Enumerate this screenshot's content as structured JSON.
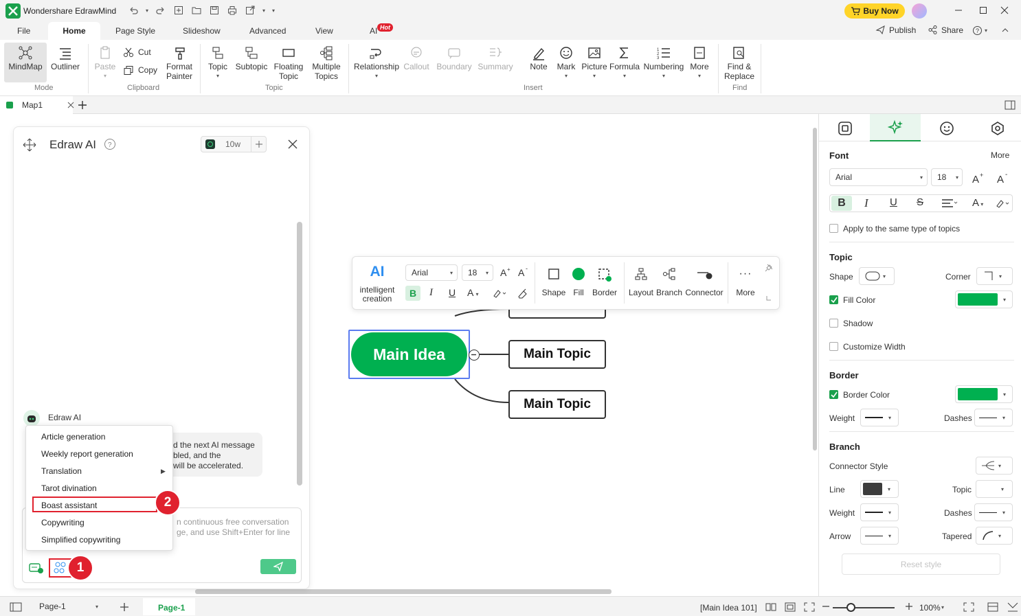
{
  "app": {
    "title": "Wondershare EdrawMind",
    "buy_now": "Buy Now",
    "publish": "Publish",
    "share": "Share"
  },
  "menu": {
    "file": "File",
    "home": "Home",
    "page_style": "Page Style",
    "slideshow": "Slideshow",
    "advanced": "Advanced",
    "view": "View",
    "ai": "AI",
    "hot": "Hot"
  },
  "ribbon": {
    "mindmap": "MindMap",
    "outliner": "Outliner",
    "mode": "Mode",
    "paste": "Paste",
    "cut": "Cut",
    "copy": "Copy",
    "format_painter_1": "Format",
    "format_painter_2": "Painter",
    "clipboard": "Clipboard",
    "topic": "Topic",
    "subtopic": "Subtopic",
    "floating_1": "Floating",
    "floating_2": "Topic",
    "multiple_1": "Multiple",
    "multiple_2": "Topics",
    "topic_group": "Topic",
    "relationship": "Relationship",
    "callout": "Callout",
    "boundary": "Boundary",
    "summary": "Summary",
    "note": "Note",
    "mark": "Mark",
    "picture": "Picture",
    "formula": "Formula",
    "numbering": "Numbering",
    "more": "More",
    "insert": "Insert",
    "find_1": "Find &",
    "find_2": "Replace",
    "find": "Find"
  },
  "tabs": {
    "doc": "Map1"
  },
  "ai_panel": {
    "title": "Edraw AI",
    "credits": "10w",
    "sender": "Edraw AI",
    "msg_line1": "d the next AI message",
    "msg_line2": "bled, and the",
    "msg_line3": "will be accelerated.",
    "input_line1": "n continuous free conversation",
    "input_line2": "ge, and use Shift+Enter for line",
    "menu": [
      "Article generation",
      "Weekly report generation",
      "Translation",
      "Tarot divination",
      "Boast assistant",
      "Copywriting",
      "Simplified copywriting"
    ],
    "badge1": "1",
    "badge2": "2"
  },
  "floatbar": {
    "ai": "AI",
    "intelligent": "intelligent",
    "creation": "creation",
    "font": "Arial",
    "size": "18",
    "shape": "Shape",
    "fill": "Fill",
    "border": "Border",
    "layout": "Layout",
    "branch": "Branch",
    "connector": "Connector",
    "more": "More"
  },
  "mindmap": {
    "main_idea": "Main Idea",
    "topic1": "Main Topic",
    "topic2": "Main Topic"
  },
  "right_panel": {
    "font": "Font",
    "more": "More",
    "font_name": "Arial",
    "font_size": "18",
    "apply_same": "Apply to the same type of topics",
    "topic": "Topic",
    "shape": "Shape",
    "corner": "Corner",
    "fill_color": "Fill Color",
    "shadow": "Shadow",
    "customize_width": "Customize Width",
    "border": "Border",
    "border_color": "Border Color",
    "weight": "Weight",
    "dashes": "Dashes",
    "branch": "Branch",
    "connector_style": "Connector Style",
    "line": "Line",
    "topic_label": "Topic",
    "weight2": "Weight",
    "dashes2": "Dashes",
    "arrow": "Arrow",
    "tapered": "Tapered",
    "reset": "Reset style"
  },
  "status": {
    "page_select": "Page-1",
    "page_tab": "Page-1",
    "selection": "[Main Idea 101]",
    "zoom": "100%"
  },
  "colors": {
    "accent": "#1aa04c",
    "fill": "#00b050",
    "badge": "#e0212e",
    "buy": "#ffd428"
  }
}
